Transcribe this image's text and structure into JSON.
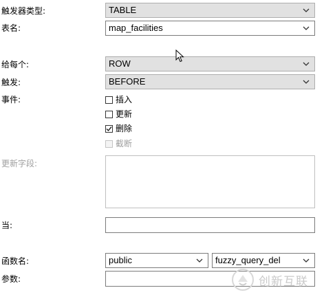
{
  "form": {
    "trigger_type": {
      "label": "触发器类型:",
      "value": "TABLE"
    },
    "table_name": {
      "label": "表名:",
      "value": "map_facilities"
    },
    "for_each": {
      "label": "给每个:",
      "value": "ROW"
    },
    "fire": {
      "label": "触发:",
      "value": "BEFORE"
    },
    "events": {
      "label": "事件:",
      "items": [
        {
          "label": "插入",
          "checked": false,
          "enabled": true
        },
        {
          "label": "更新",
          "checked": false,
          "enabled": true
        },
        {
          "label": "删除",
          "checked": true,
          "enabled": true
        },
        {
          "label": "截断",
          "checked": false,
          "enabled": false
        }
      ]
    },
    "update_fields": {
      "label": "更新字段:",
      "value": ""
    },
    "when": {
      "label": "当:",
      "value": ""
    },
    "function": {
      "label": "函数名:",
      "schema": "public",
      "name": "fuzzy_query_del"
    },
    "params": {
      "label": "参数:",
      "value": ""
    }
  },
  "watermark": {
    "text": "创新互联",
    "icon": "brand-logo-icon"
  }
}
